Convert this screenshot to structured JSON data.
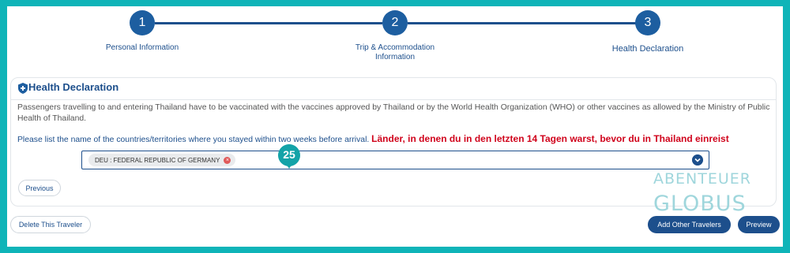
{
  "stepper": {
    "steps": [
      {
        "number": "1",
        "label": "Personal Information"
      },
      {
        "number": "2",
        "label_line1": "Trip & Accommodation",
        "label_line2": "Information"
      },
      {
        "number": "3",
        "label": "Health Declaration"
      }
    ]
  },
  "panel": {
    "title": "Health Declaration",
    "description": "Passengers travelling to and entering Thailand have to be vaccinated with the vaccines approved by Thailand or by the World Health Organization (WHO) or other vaccines as allowed by the Ministry of Public Health of Thailand.",
    "instruction": "Please list the name of the countries/territories where you stayed within two weeks before arrival.",
    "annotation": "Länder, in denen du in den letzten 14 Tagen warst, bevor du in Thailand einreist",
    "selected_country": "DEU : FEDERAL REPUBLIC OF GERMANY",
    "badge_number": "25",
    "previous_label": "Previous"
  },
  "footer": {
    "delete_label": "Delete This Traveler",
    "add_travelers_label": "Add Other Travelers",
    "preview_label": "Preview"
  },
  "watermark": {
    "line1": "ABENTEUER",
    "line2": "GLOBUS"
  },
  "colors": {
    "accent": "#1d4f8c",
    "annotation": "#d0021b",
    "background": "#0fb4b8"
  }
}
